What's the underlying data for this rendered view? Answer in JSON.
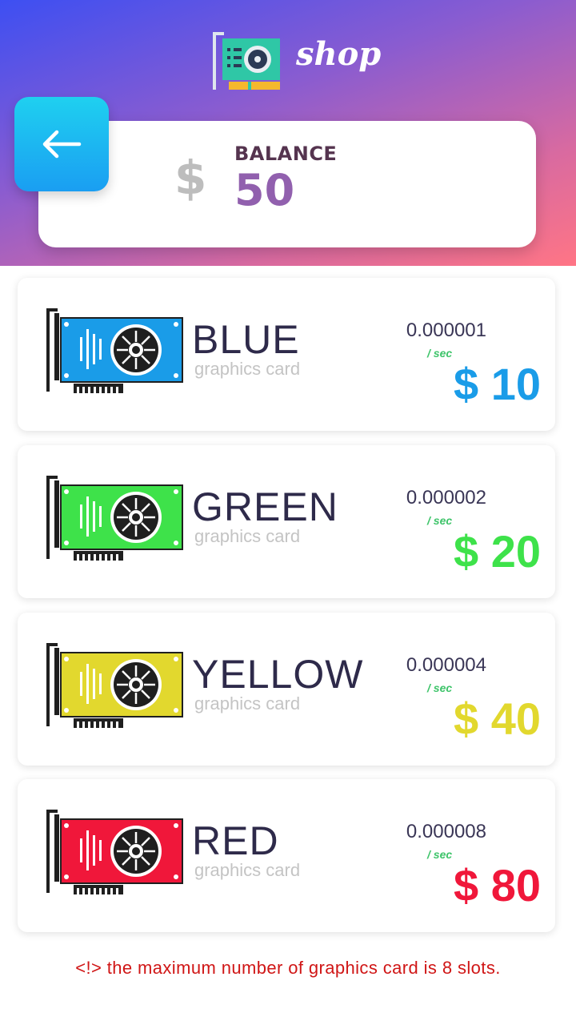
{
  "header": {
    "title": "shop",
    "logo_icon": "graphics-card-logo-icon",
    "back_icon": "arrow-left-icon"
  },
  "balance": {
    "currency_icon": "dollar-icon",
    "currency_symbol": "$",
    "label": "BALANCE",
    "value": "50"
  },
  "cards": [
    {
      "name": "BLUE",
      "subtitle": "graphics card",
      "rate": "0.000001",
      "per": "/ sec",
      "price": "$ 10",
      "color": "#1a9ce8"
    },
    {
      "name": "GREEN",
      "subtitle": "graphics card",
      "rate": "0.000002",
      "per": "/ sec",
      "price": "$ 20",
      "color": "#3ee24a"
    },
    {
      "name": "YELLOW",
      "subtitle": "graphics card",
      "rate": "0.000004",
      "per": "/ sec",
      "price": "$ 40",
      "color": "#e2d82e"
    },
    {
      "name": "RED",
      "subtitle": "graphics card",
      "rate": "0.000008",
      "per": "/ sec",
      "price": "$ 80",
      "color": "#f0173a"
    }
  ],
  "footer": {
    "note": "<!>  the maximum number of graphics card is 8 slots.",
    "note_color": "#d01616"
  }
}
